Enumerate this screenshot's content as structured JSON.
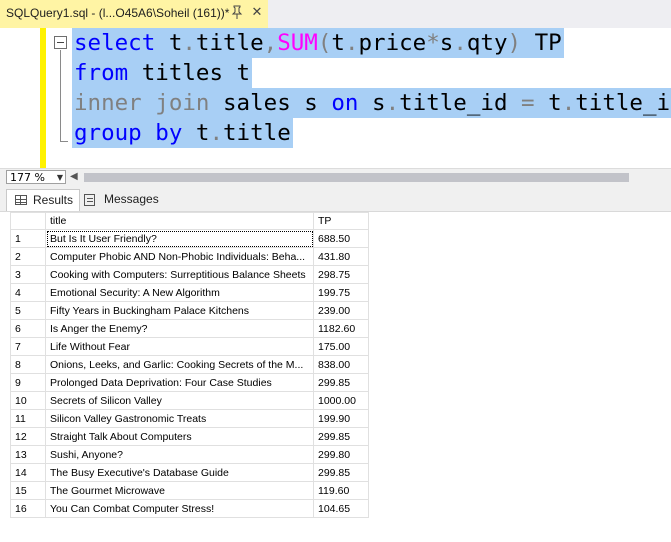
{
  "tab": {
    "title": "SQLQuery1.sql - (l...O45A6\\Soheil (161))*",
    "pin_icon": "pin-icon",
    "close_icon": "close-icon"
  },
  "editor": {
    "lines": [
      [
        "select",
        " t",
        ".",
        "title",
        ",",
        "SUM",
        "(",
        "t",
        ".",
        "price",
        "*",
        "s",
        ".",
        "qty",
        ")",
        " TP"
      ],
      [
        "from",
        " titles t"
      ],
      [
        "inner join",
        " sales s ",
        "on",
        " s",
        ".",
        "title_id ",
        "=",
        " t",
        ".",
        "title_id"
      ],
      [
        "group by",
        " t",
        ".",
        "title"
      ]
    ]
  },
  "zoom": {
    "value": "177 %"
  },
  "result_tabs": {
    "results": "Results",
    "messages": "Messages"
  },
  "grid": {
    "columns": [
      "title",
      "TP"
    ],
    "rows": [
      [
        "1",
        "But Is It User Friendly?",
        "688.50"
      ],
      [
        "2",
        "Computer Phobic AND Non-Phobic Individuals: Beha...",
        "431.80"
      ],
      [
        "3",
        "Cooking with Computers: Surreptitious Balance Sheets",
        "298.75"
      ],
      [
        "4",
        "Emotional Security: A New Algorithm",
        "199.75"
      ],
      [
        "5",
        "Fifty Years in Buckingham Palace Kitchens",
        "239.00"
      ],
      [
        "6",
        "Is Anger the Enemy?",
        "1182.60"
      ],
      [
        "7",
        "Life Without Fear",
        "175.00"
      ],
      [
        "8",
        "Onions, Leeks, and Garlic: Cooking Secrets of the M...",
        "838.00"
      ],
      [
        "9",
        "Prolonged Data Deprivation: Four Case Studies",
        "299.85"
      ],
      [
        "10",
        "Secrets of Silicon Valley",
        "1000.00"
      ],
      [
        "11",
        "Silicon Valley Gastronomic Treats",
        "199.90"
      ],
      [
        "12",
        "Straight Talk About Computers",
        "299.85"
      ],
      [
        "13",
        "Sushi, Anyone?",
        "299.80"
      ],
      [
        "14",
        "The Busy Executive's Database Guide",
        "299.85"
      ],
      [
        "15",
        "The Gourmet Microwave",
        "119.60"
      ],
      [
        "16",
        "You Can Combat Computer Stress!",
        "104.65"
      ]
    ]
  }
}
